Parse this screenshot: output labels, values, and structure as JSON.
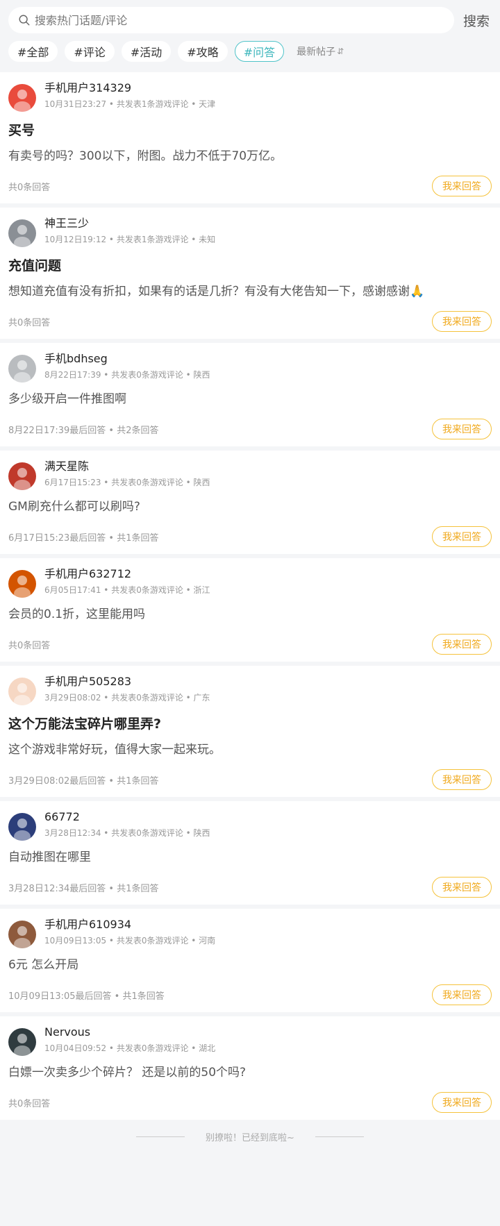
{
  "search": {
    "placeholder": "搜索热门话题/评论",
    "button": "搜索"
  },
  "tags": [
    "#全部",
    "#评论",
    "#活动",
    "#攻略",
    "#问答"
  ],
  "active_tag": "#问答",
  "sort_label": "最新帖子",
  "answer_label": "我来回答",
  "posts": [
    {
      "username": "手机用户314329",
      "meta": "10月31日23:27 • 共发表1条游戏评论 • 天津",
      "title": "买号",
      "content": "有卖号的吗？300以下，附图。战力不低于70万亿。",
      "footer": "共0条回答",
      "avatar_color": "#e94b3c"
    },
    {
      "username": "神王三少",
      "meta": "10月12日19:12 • 共发表1条游戏评论 • 未知",
      "title": "充值问题",
      "content": "想知道充值有没有折扣，如果有的话是几折？有没有大佬告知一下，感谢感谢🙏",
      "footer": "共0条回答",
      "avatar_color": "#8a8f95"
    },
    {
      "username": "手机bdhseg",
      "meta": "8月22日17:39 • 共发表0条游戏评论 • 陕西",
      "title": "",
      "content": "多少级开启一件推图啊",
      "footer": "8月22日17:39最后回答 • 共2条回答",
      "avatar_color": "#b9bcbf"
    },
    {
      "username": "满天星陈",
      "meta": "6月17日15:23 • 共发表0条游戏评论 • 陕西",
      "title": "",
      "content": "GM刷充什么都可以刷吗?",
      "footer": "6月17日15:23最后回答 • 共1条回答",
      "avatar_color": "#c0392b"
    },
    {
      "username": "手机用户632712",
      "meta": "6月05日17:41 • 共发表0条游戏评论 • 浙江",
      "title": "",
      "content": "会员的0.1折，这里能用吗",
      "footer": "共0条回答",
      "avatar_color": "#d35400"
    },
    {
      "username": "手机用户505283",
      "meta": "3月29日08:02 • 共发表0条游戏评论 • 广东",
      "title": "这个万能法宝碎片哪里弄?",
      "content": "这个游戏非常好玩，值得大家一起来玩。",
      "footer": "3月29日08:02最后回答 • 共1条回答",
      "avatar_color": "#f6d7c3"
    },
    {
      "username": "66772",
      "meta": "3月28日12:34 • 共发表0条游戏评论 • 陕西",
      "title": "",
      "content": "自动推图在哪里",
      "footer": "3月28日12:34最后回答 • 共1条回答",
      "avatar_color": "#2c3e7a"
    },
    {
      "username": "手机用户610934",
      "meta": "10月09日13:05 • 共发表0条游戏评论 • 河南",
      "title": "",
      "content": "6元 怎么开局",
      "footer": "10月09日13:05最后回答 • 共1条回答",
      "avatar_color": "#8e5a3c"
    },
    {
      "username": "Nervous",
      "meta": "10月04日09:52 • 共发表0条游戏评论 • 湖北",
      "title": "",
      "content": "白嫖一次卖多少个碎片？ 还是以前的50个吗?",
      "footer": "共0条回答",
      "avatar_color": "#2f3b3f"
    }
  ],
  "footer_text": "别撩啦！已经到底啦~"
}
